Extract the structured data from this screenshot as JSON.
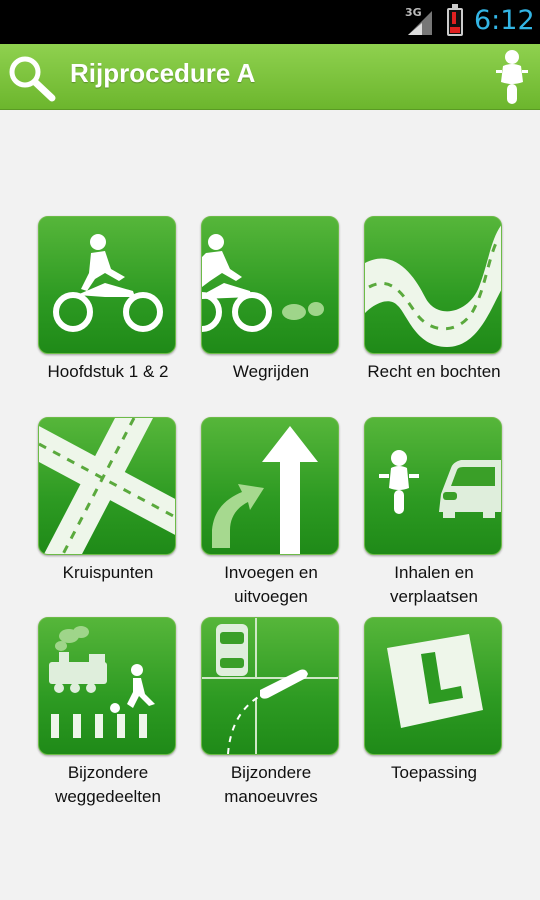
{
  "status_bar": {
    "network": "3G",
    "time": "6:12",
    "icons": [
      "signal-icon",
      "battery-low-icon"
    ]
  },
  "action_bar": {
    "title": "Rijprocedure A",
    "left_icon": "search-icon",
    "right_icon": "motorcycle-rider-icon"
  },
  "colors": {
    "accent": "#6cb62d",
    "tile_green": "#2d9a22",
    "clock_blue": "#33b5e5"
  },
  "tiles": [
    {
      "label": "Hoofdstuk 1 & 2",
      "icon": "motorcycle-icon"
    },
    {
      "label": "Wegrijden",
      "icon": "motorcycle-departing-icon"
    },
    {
      "label": "Recht en bochten",
      "icon": "curved-road-icon"
    },
    {
      "label": "Kruispunten",
      "icon": "intersection-icon"
    },
    {
      "label": "Invoegen en uitvoegen",
      "icon": "merge-arrows-icon"
    },
    {
      "label": "Inhalen en verplaatsen",
      "icon": "overtaking-icon"
    },
    {
      "label": "Bijzondere weggedeelten",
      "icon": "train-crosswalk-icon"
    },
    {
      "label": "Bijzondere manoeuvres",
      "icon": "parking-maneuver-icon"
    },
    {
      "label": "Toepassing",
      "icon": "learner-plate-icon"
    }
  ]
}
